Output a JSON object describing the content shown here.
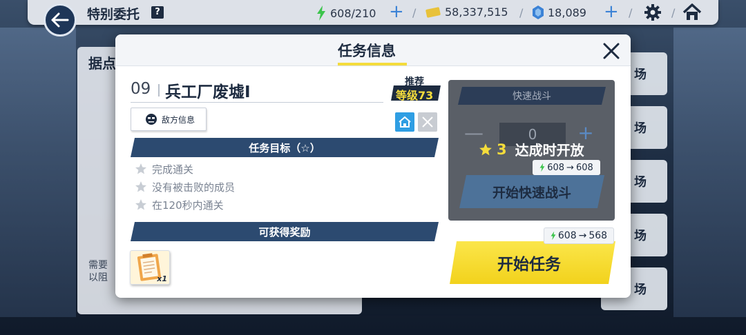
{
  "top_bar": {
    "title": "特别委托",
    "help_label": "?",
    "stamina": "608/210",
    "credits": "58,337,515",
    "gems": "18,089",
    "separator": "/"
  },
  "background": {
    "left_panel_title": "据点",
    "left_panel_text_1": "需要",
    "left_panel_text_2": "以阻",
    "right_item_labels": [
      "场",
      "场",
      "场",
      "场",
      "场"
    ]
  },
  "modal": {
    "title": "任务信息",
    "mission_number": "09",
    "mission_name": "兵工厂废墟I",
    "recommend_label": "推荐",
    "recommend_level": "等级73",
    "enemy_info_label": "敌方信息",
    "objectives_header": "任务目标（☆）",
    "objectives": [
      "完成通关",
      "没有被击败的成员",
      "在120秒内通关"
    ],
    "rewards_header": "可获得奖励",
    "reward_count": "x1",
    "quick_battle": {
      "title": "快速战斗",
      "count": "0",
      "minus": "—",
      "plus": "+",
      "unlock_stars": "3",
      "unlock_text": "达成时开放",
      "cost_from": "608",
      "cost_to": "608",
      "button_label": "开始快速战斗"
    },
    "start": {
      "cost_from": "608",
      "cost_to": "568",
      "button_label": "开始任务"
    }
  },
  "colors": {
    "navy": "#1d2b40",
    "section_bar": "#2c4a70",
    "accent_yellow": "#f4dc3b",
    "stamina_green": "#3cc44c"
  }
}
